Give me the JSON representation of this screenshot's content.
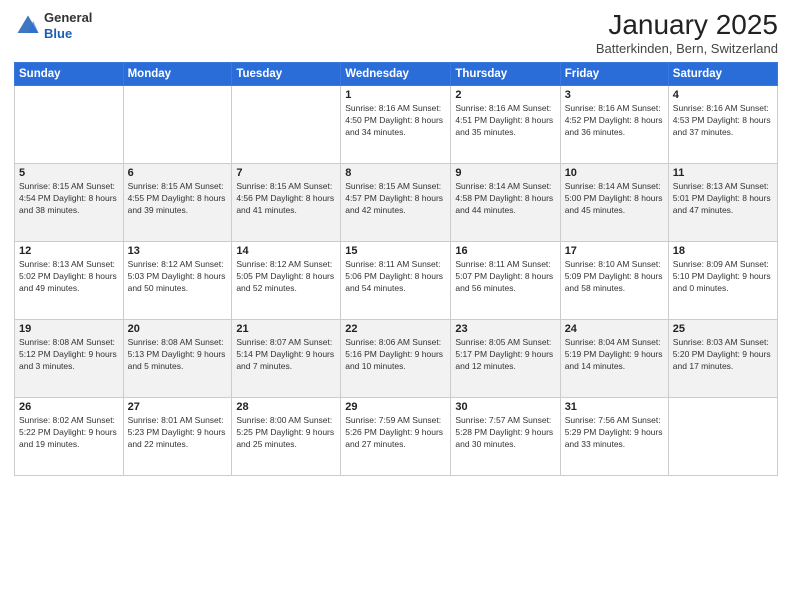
{
  "logo": {
    "general": "General",
    "blue": "Blue"
  },
  "header": {
    "title": "January 2025",
    "subtitle": "Batterkinden, Bern, Switzerland"
  },
  "weekdays": [
    "Sunday",
    "Monday",
    "Tuesday",
    "Wednesday",
    "Thursday",
    "Friday",
    "Saturday"
  ],
  "weeks": [
    [
      {
        "day": "",
        "info": ""
      },
      {
        "day": "",
        "info": ""
      },
      {
        "day": "",
        "info": ""
      },
      {
        "day": "1",
        "info": "Sunrise: 8:16 AM\nSunset: 4:50 PM\nDaylight: 8 hours\nand 34 minutes."
      },
      {
        "day": "2",
        "info": "Sunrise: 8:16 AM\nSunset: 4:51 PM\nDaylight: 8 hours\nand 35 minutes."
      },
      {
        "day": "3",
        "info": "Sunrise: 8:16 AM\nSunset: 4:52 PM\nDaylight: 8 hours\nand 36 minutes."
      },
      {
        "day": "4",
        "info": "Sunrise: 8:16 AM\nSunset: 4:53 PM\nDaylight: 8 hours\nand 37 minutes."
      }
    ],
    [
      {
        "day": "5",
        "info": "Sunrise: 8:15 AM\nSunset: 4:54 PM\nDaylight: 8 hours\nand 38 minutes."
      },
      {
        "day": "6",
        "info": "Sunrise: 8:15 AM\nSunset: 4:55 PM\nDaylight: 8 hours\nand 39 minutes."
      },
      {
        "day": "7",
        "info": "Sunrise: 8:15 AM\nSunset: 4:56 PM\nDaylight: 8 hours\nand 41 minutes."
      },
      {
        "day": "8",
        "info": "Sunrise: 8:15 AM\nSunset: 4:57 PM\nDaylight: 8 hours\nand 42 minutes."
      },
      {
        "day": "9",
        "info": "Sunrise: 8:14 AM\nSunset: 4:58 PM\nDaylight: 8 hours\nand 44 minutes."
      },
      {
        "day": "10",
        "info": "Sunrise: 8:14 AM\nSunset: 5:00 PM\nDaylight: 8 hours\nand 45 minutes."
      },
      {
        "day": "11",
        "info": "Sunrise: 8:13 AM\nSunset: 5:01 PM\nDaylight: 8 hours\nand 47 minutes."
      }
    ],
    [
      {
        "day": "12",
        "info": "Sunrise: 8:13 AM\nSunset: 5:02 PM\nDaylight: 8 hours\nand 49 minutes."
      },
      {
        "day": "13",
        "info": "Sunrise: 8:12 AM\nSunset: 5:03 PM\nDaylight: 8 hours\nand 50 minutes."
      },
      {
        "day": "14",
        "info": "Sunrise: 8:12 AM\nSunset: 5:05 PM\nDaylight: 8 hours\nand 52 minutes."
      },
      {
        "day": "15",
        "info": "Sunrise: 8:11 AM\nSunset: 5:06 PM\nDaylight: 8 hours\nand 54 minutes."
      },
      {
        "day": "16",
        "info": "Sunrise: 8:11 AM\nSunset: 5:07 PM\nDaylight: 8 hours\nand 56 minutes."
      },
      {
        "day": "17",
        "info": "Sunrise: 8:10 AM\nSunset: 5:09 PM\nDaylight: 8 hours\nand 58 minutes."
      },
      {
        "day": "18",
        "info": "Sunrise: 8:09 AM\nSunset: 5:10 PM\nDaylight: 9 hours\nand 0 minutes."
      }
    ],
    [
      {
        "day": "19",
        "info": "Sunrise: 8:08 AM\nSunset: 5:12 PM\nDaylight: 9 hours\nand 3 minutes."
      },
      {
        "day": "20",
        "info": "Sunrise: 8:08 AM\nSunset: 5:13 PM\nDaylight: 9 hours\nand 5 minutes."
      },
      {
        "day": "21",
        "info": "Sunrise: 8:07 AM\nSunset: 5:14 PM\nDaylight: 9 hours\nand 7 minutes."
      },
      {
        "day": "22",
        "info": "Sunrise: 8:06 AM\nSunset: 5:16 PM\nDaylight: 9 hours\nand 10 minutes."
      },
      {
        "day": "23",
        "info": "Sunrise: 8:05 AM\nSunset: 5:17 PM\nDaylight: 9 hours\nand 12 minutes."
      },
      {
        "day": "24",
        "info": "Sunrise: 8:04 AM\nSunset: 5:19 PM\nDaylight: 9 hours\nand 14 minutes."
      },
      {
        "day": "25",
        "info": "Sunrise: 8:03 AM\nSunset: 5:20 PM\nDaylight: 9 hours\nand 17 minutes."
      }
    ],
    [
      {
        "day": "26",
        "info": "Sunrise: 8:02 AM\nSunset: 5:22 PM\nDaylight: 9 hours\nand 19 minutes."
      },
      {
        "day": "27",
        "info": "Sunrise: 8:01 AM\nSunset: 5:23 PM\nDaylight: 9 hours\nand 22 minutes."
      },
      {
        "day": "28",
        "info": "Sunrise: 8:00 AM\nSunset: 5:25 PM\nDaylight: 9 hours\nand 25 minutes."
      },
      {
        "day": "29",
        "info": "Sunrise: 7:59 AM\nSunset: 5:26 PM\nDaylight: 9 hours\nand 27 minutes."
      },
      {
        "day": "30",
        "info": "Sunrise: 7:57 AM\nSunset: 5:28 PM\nDaylight: 9 hours\nand 30 minutes."
      },
      {
        "day": "31",
        "info": "Sunrise: 7:56 AM\nSunset: 5:29 PM\nDaylight: 9 hours\nand 33 minutes."
      },
      {
        "day": "",
        "info": ""
      }
    ]
  ]
}
